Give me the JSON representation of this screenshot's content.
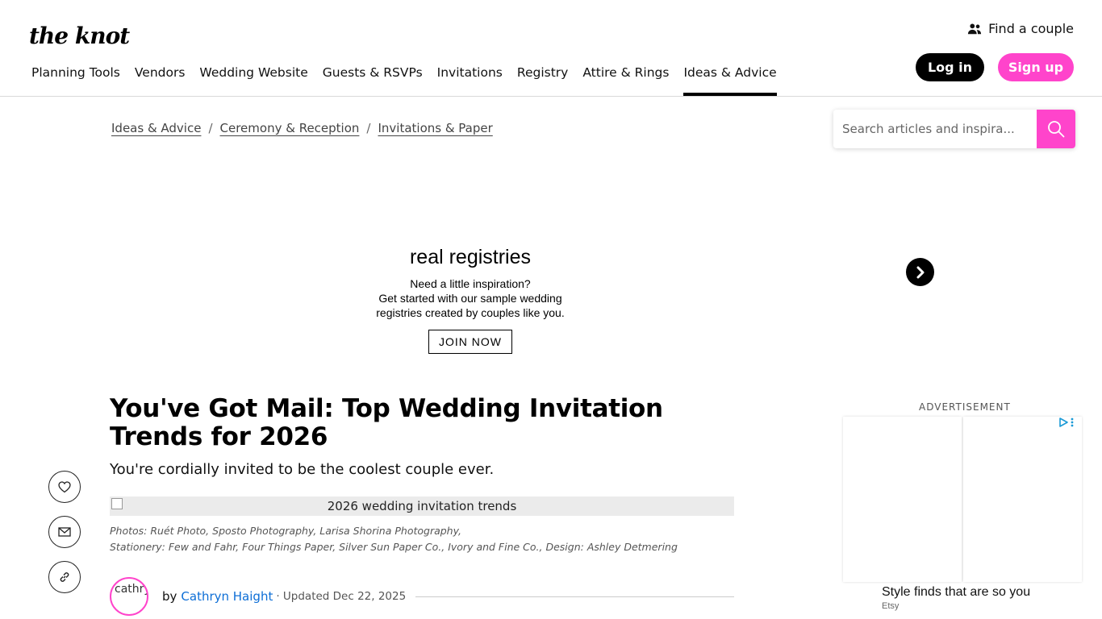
{
  "header": {
    "logo": "the knot",
    "find_couple": "Find a couple",
    "login": "Log in",
    "signup": "Sign up"
  },
  "nav": {
    "items": [
      {
        "label": "Planning Tools"
      },
      {
        "label": "Vendors"
      },
      {
        "label": "Wedding Website"
      },
      {
        "label": "Guests & RSVPs"
      },
      {
        "label": "Invitations"
      },
      {
        "label": "Registry"
      },
      {
        "label": "Attire & Rings"
      },
      {
        "label": "Ideas & Advice",
        "active": true
      }
    ]
  },
  "breadcrumb": {
    "items": [
      "Ideas & Advice",
      "Ceremony & Reception",
      "Invitations & Paper"
    ],
    "separator": "/"
  },
  "search": {
    "placeholder": "Search articles and inspira..."
  },
  "ad_banner": {
    "title": "real registries",
    "text": "Need a little inspiration?\nGet started with our sample wedding registries created by couples like you.",
    "line1": "Need a little inspiration?",
    "line2": "Get started with our sample wedding",
    "line3": "registries created by couples like you.",
    "cta": "JOIN NOW"
  },
  "article": {
    "title": "You've Got Mail: Top Wedding Invitation Trends for 2026",
    "subtitle": "You're cordially invited to be the coolest couple ever.",
    "hero_alt": "2026 wedding invitation trends",
    "credits_line1": "Photos: Ruét Photo, Sposto Photography, Larisa Shorina Photography,",
    "credits_line2": "Stationery: Few and Fahr, Four Things Paper, Silver Sun Paper Co., Ivory and Fine Co., Design: Ashley Detmering",
    "byline_prefix": "by",
    "author": "Cathryn Haight",
    "avatar_alt": "cathryn",
    "updated": "· Updated Dec 22, 2025"
  },
  "sidebar_ad": {
    "label": "ADVERTISEMENT",
    "caption": "Style finds that are so you",
    "source": "Etsy"
  },
  "colors": {
    "brand_pink": "#ff44cb",
    "link_blue": "#0d6ed6",
    "black": "#000000"
  },
  "icons": [
    "users-icon",
    "search-icon",
    "chevron-right-icon",
    "heart-icon",
    "mail-icon",
    "link-icon",
    "ad-choices-icon"
  ]
}
